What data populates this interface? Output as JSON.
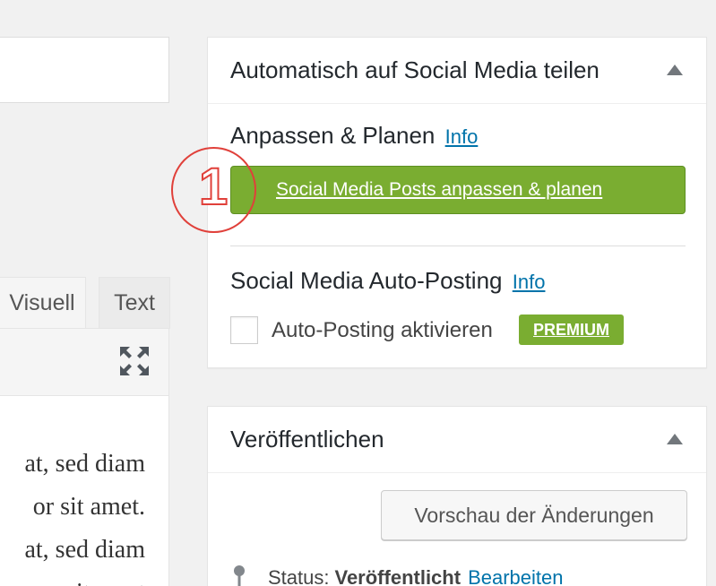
{
  "editor": {
    "tabs": {
      "visual": "Visuell",
      "text": "Text"
    },
    "expand_icon": "fullscreen-icon",
    "content_lines": [
      "at, sed diam",
      "or sit amet.",
      "at, sed diam",
      "r sit amet"
    ]
  },
  "share_box": {
    "title": "Automatisch auf Social Media teilen",
    "customize": {
      "heading": "Anpassen & Planen",
      "info_link": "Info",
      "button_label": "Social Media Posts anpassen & planen"
    },
    "auto_posting": {
      "heading": "Social Media Auto-Posting",
      "info_link": "Info",
      "checkbox_label": "Auto-Posting aktivieren",
      "checked": false,
      "badge": "PREMIUM"
    },
    "annotation": "1"
  },
  "publish_box": {
    "title": "Veröffentlichen",
    "preview_button": "Vorschau der Änderungen",
    "status_label": "Status:",
    "status_value": "Veröffentlicht",
    "status_edit": "Bearbeiten"
  },
  "colors": {
    "accent_green": "#7aad31",
    "link_blue": "#0073aa",
    "annotation_red": "#e0403a"
  }
}
